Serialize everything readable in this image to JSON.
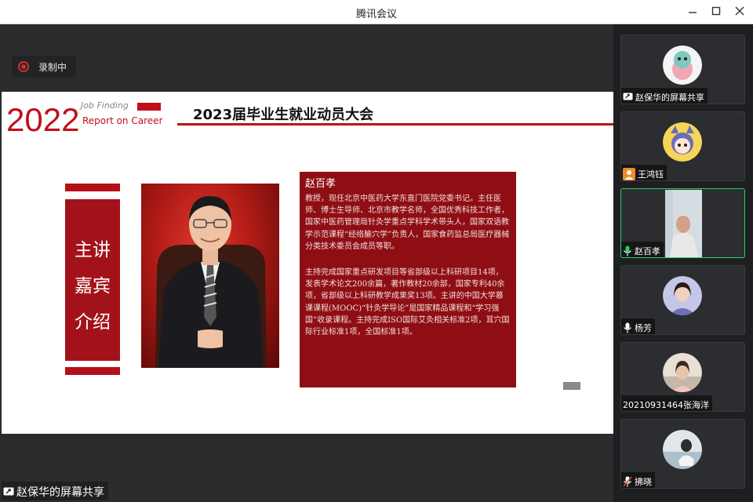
{
  "window": {
    "title": "腾讯会议"
  },
  "recording": {
    "label": "录制中"
  },
  "slide": {
    "year": "2022",
    "job_finding": "Job Finding",
    "report": "Report on Career",
    "title": "2023届毕业生就业动员大会",
    "banner_lines": [
      "主讲",
      "嘉宾",
      "介绍"
    ],
    "speaker_name": "赵百孝",
    "bio_p1": "教授，现任北京中医药大学东直门医院党委书记。主任医师、博士生导师、北京市教学名师，全国优秀科技工作者，国家中医药管理局针灸学重点学科学术带头人，国家双语教学示范课程“经络腧穴学”负责人，国家食药监总局医疗器械分类技术委员会成员等职。",
    "bio_p2": "主持完成国家重点研发项目等省部级以上科研项目14项，发表学术论文200余篇，著作教材20余部，国家专利40余项，省部级以上科研教学成果奖13项。主讲的中国大学慕课课程(MOOC)“针灸学导论”是国家精品课程和“学习强国”收录课程。主持完成ISO国际艾灸相关标准2项，耳穴国际行业标准1项，全国标准1项。"
  },
  "share_label": "赵保华的屏幕共享",
  "participants": [
    {
      "name": "赵保华的屏幕共享",
      "icon": "screen-share-icon"
    },
    {
      "name": "王鸿钰",
      "icon": "person-icon"
    },
    {
      "name": "赵百孝",
      "icon": "mic-active-icon",
      "active": true
    },
    {
      "name": "杨芳",
      "icon": "mic-icon"
    },
    {
      "name": "20210931464张海洋",
      "icon": ""
    },
    {
      "name": "拂晓",
      "icon": "mic-muted-icon"
    }
  ],
  "colors": {
    "accent_red": "#c0101a",
    "bio_bg": "#8e0e14",
    "active_border": "#2bd06a"
  }
}
